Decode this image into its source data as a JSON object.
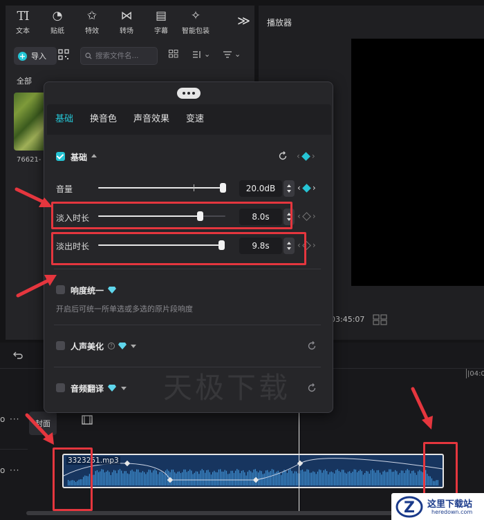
{
  "toolbar": {
    "items": [
      {
        "icon": "text-icon",
        "label": "文本",
        "glyph": "TI"
      },
      {
        "icon": "sticker-icon",
        "label": "贴纸",
        "glyph": "◔"
      },
      {
        "icon": "effects-icon",
        "label": "特效",
        "glyph": "✩"
      },
      {
        "icon": "transition-icon",
        "label": "转场",
        "glyph": "⋈"
      },
      {
        "icon": "subtitle-icon",
        "label": "字幕",
        "glyph": "▤"
      },
      {
        "icon": "smart-pack-icon",
        "label": "智能包装",
        "glyph": "✧"
      }
    ],
    "more": "≫"
  },
  "media": {
    "import_label": "导入",
    "search_placeholder": "搜索文件名...",
    "all_label": "全部",
    "thumb_name": "76621-"
  },
  "player": {
    "title": "播放器",
    "time": "03:45:07"
  },
  "timeline": {
    "ruler_time": "|04:0",
    "cover_label": "封面",
    "clip_name": "3323251.mp3"
  },
  "popup": {
    "tabs": [
      "基础",
      "换音色",
      "声音效果",
      "变速"
    ],
    "active_tab": "基础",
    "section_basic": "基础",
    "params": [
      {
        "label": "音量",
        "value": "20.0dB",
        "level": 1.0,
        "keyframe": true
      },
      {
        "label": "淡入时长",
        "value": "8.0s",
        "level": 0.8,
        "keyframe": false
      },
      {
        "label": "淡出时长",
        "value": "9.8s",
        "level": 0.98,
        "keyframe": false
      }
    ],
    "loudness_label": "响度统一",
    "loudness_hint": "开启后可统一所单选或多选的原片段响度",
    "voice_beautify_label": "人声美化",
    "audio_translate_label": "音频翻译"
  },
  "watermark": "天极下载",
  "logo": {
    "line1": "这里下载站",
    "line2": "heredown.com",
    "mark": "Z"
  },
  "colors": {
    "accent": "#25c4d4",
    "annotation": "#e5363e",
    "background": "#141416"
  }
}
